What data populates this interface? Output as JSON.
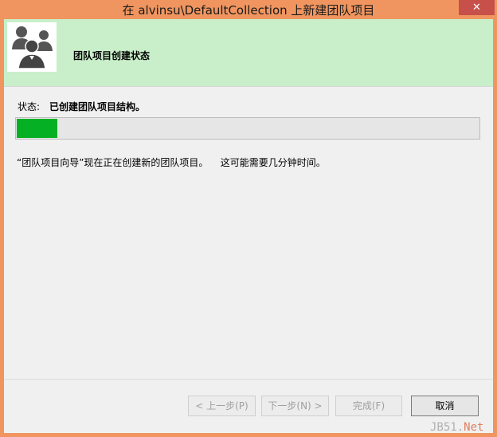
{
  "window": {
    "title": "在 alvinsu\\DefaultCollection 上新建团队项目",
    "help": "?",
    "close": "✕"
  },
  "header": {
    "title": "团队项目创建状态",
    "logo_icon": "team-people-icon"
  },
  "status": {
    "label": "状态:",
    "value": "已创建团队项目结构。"
  },
  "progress": {
    "percent": 9,
    "color": "#06b025"
  },
  "description": "“团队项目向导”现在正在创建新的团队项目。    这可能需要几分钟时间。",
  "buttons": {
    "back": "< 上一步(P)",
    "next": "下一步(N) >",
    "finish": "完成(F)",
    "cancel": "取消"
  },
  "watermark": {
    "prefix": "JB51.",
    "suffix": "Net"
  },
  "colors": {
    "titlebar": "#f0955f",
    "header_bg": "#c8efc9",
    "close_btn": "#c7504a"
  }
}
